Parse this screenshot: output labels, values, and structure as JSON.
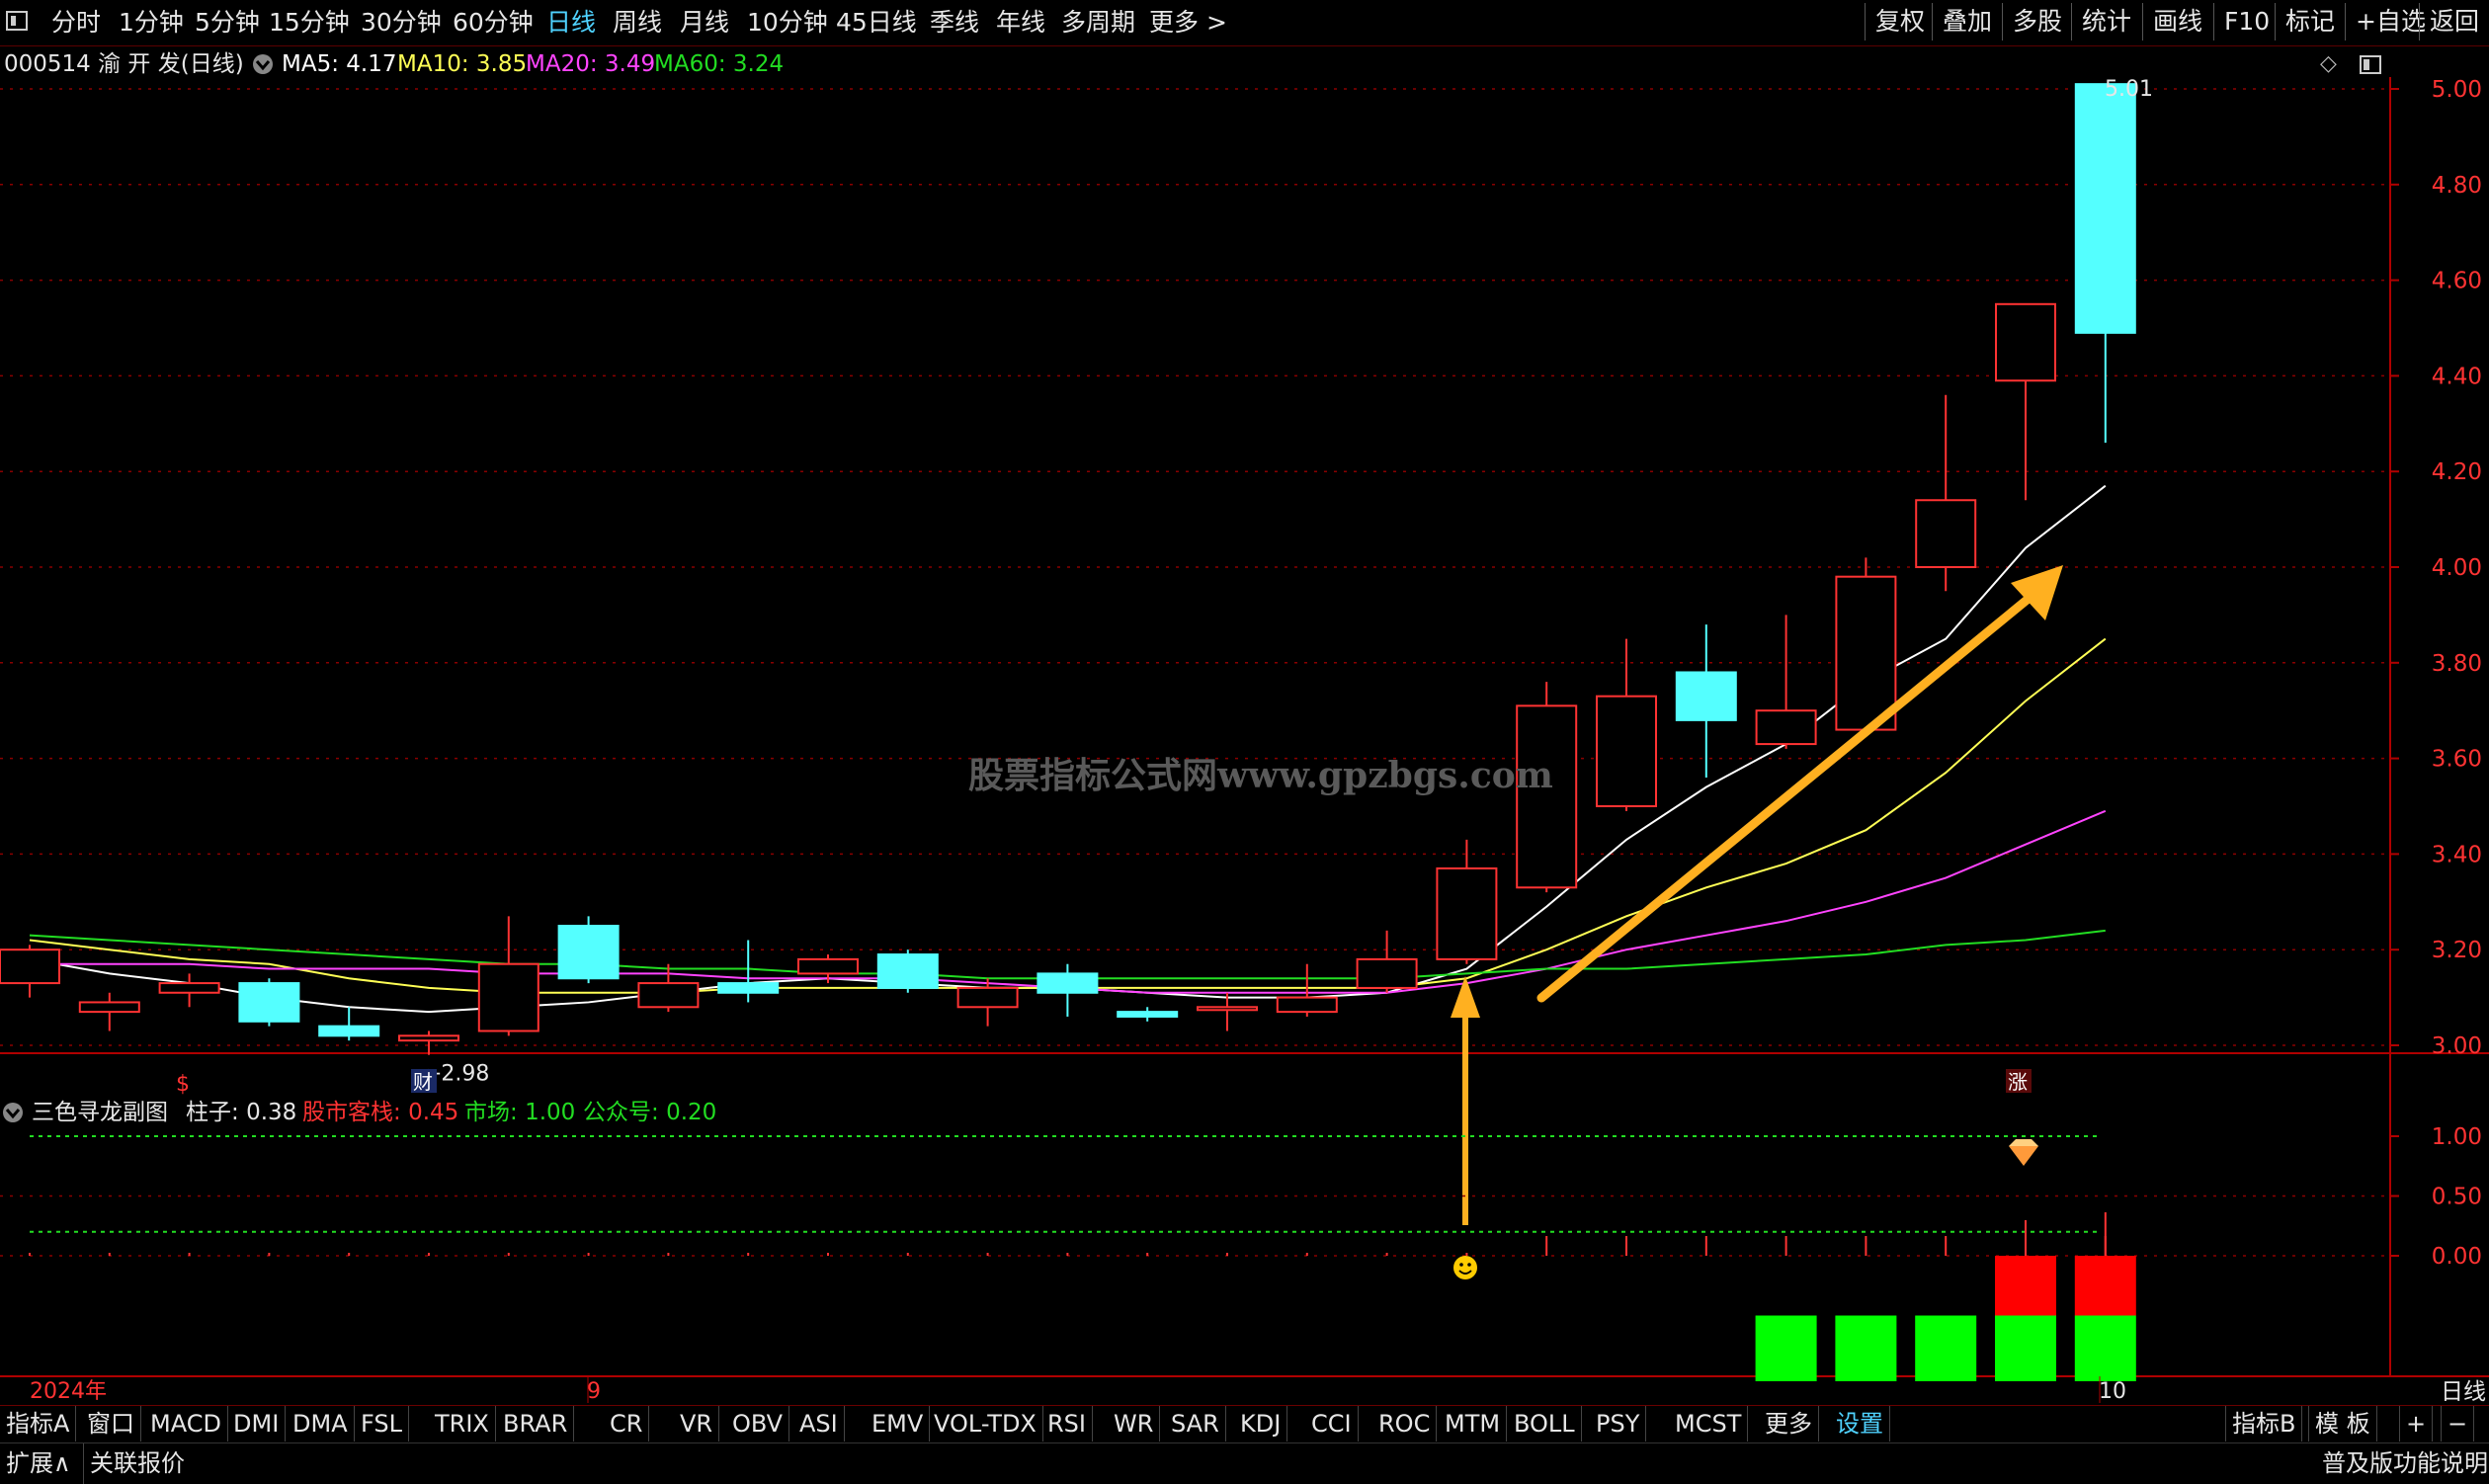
{
  "toolbar": {
    "periods": [
      "分时",
      "1分钟",
      "5分钟",
      "15分钟",
      "30分钟",
      "60分钟",
      "日线",
      "周线",
      "月线",
      "10分钟",
      "45日线",
      "季线",
      "年线",
      "多周期",
      "更多 >"
    ],
    "active_period": "日线",
    "right_buttons": [
      "复权",
      "叠加",
      "多股",
      "统计",
      "画线",
      "F10",
      "标记",
      "+自选",
      "返回"
    ]
  },
  "stock": {
    "code_name": "000514 渝 开 发(日线)",
    "ma5_label": "MA5:",
    "ma5_value": "4.17",
    "ma10_label": "MA10:",
    "ma10_value": "3.85",
    "ma20_label": "MA20:",
    "ma20_value": "3.49",
    "ma60_label": "MA60:",
    "ma60_value": "3.24"
  },
  "colors": {
    "ma5": "#ffffff",
    "ma10": "#ffff55",
    "ma20": "#ff44ff",
    "ma60": "#22dd22",
    "up": "#ff3333",
    "down": "#54ffff",
    "accent": "#4fd2ff",
    "arrow": "#ffb020"
  },
  "watermark": "股票指标公式网www.gpzbgs.com",
  "price_axis": [
    "5.00",
    "4.80",
    "4.60",
    "4.40",
    "4.20",
    "4.00",
    "3.80",
    "3.60",
    "3.40",
    "3.20",
    "3.00"
  ],
  "annotations": {
    "high_label": "5.01",
    "low_label": "←2.98",
    "cai_marker": "财",
    "zhang_marker": "涨",
    "dollar_marker": "$"
  },
  "sub_chart": {
    "title": "三色寻龙副图",
    "zhuzi_label": "柱子:",
    "zhuzi_value": "0.38",
    "gushi_label": "股市客栈:",
    "gushi_value": "0.45",
    "shichang_label": "市场:",
    "shichang_value": "1.00",
    "gzh_label": "公众号:",
    "gzh_value": "0.20",
    "axis": [
      "1.00",
      "0.50",
      "0.00"
    ]
  },
  "date_axis": {
    "year_label": "2024年",
    "month_9": "9",
    "month_10": "10",
    "period_label": "日线"
  },
  "indicator_tabs": [
    "指标A",
    "窗口",
    "MACD",
    "DMI",
    "DMA",
    "FSL",
    "TRIX",
    "BRAR",
    "CR",
    "VR",
    "OBV",
    "ASI",
    "EMV",
    "VOL-TDX",
    "RSI",
    "WR",
    "SAR",
    "KDJ",
    "CCI",
    "ROC",
    "MTM",
    "BOLL",
    "PSY",
    "MCST",
    "更多",
    "设置"
  ],
  "active_tab": "设置",
  "bottom_right": [
    "指标B",
    "模 板",
    "+",
    "−"
  ],
  "status": {
    "expand": "扩展∧",
    "related_quote": "关联报价",
    "edition": "普及版功能说明"
  },
  "chart_data": {
    "type": "candlestick",
    "ylim": [
      2.9,
      5.05
    ],
    "candles": [
      {
        "o": 3.13,
        "c": 3.2,
        "h": 3.21,
        "l": 3.1
      },
      {
        "o": 3.07,
        "c": 3.09,
        "h": 3.11,
        "l": 3.03
      },
      {
        "o": 3.11,
        "c": 3.13,
        "h": 3.15,
        "l": 3.08
      },
      {
        "o": 3.13,
        "c": 3.05,
        "h": 3.14,
        "l": 3.04
      },
      {
        "o": 3.04,
        "c": 3.02,
        "h": 3.08,
        "l": 3.01
      },
      {
        "o": 3.01,
        "c": 3.02,
        "h": 3.03,
        "l": 2.98
      },
      {
        "o": 3.03,
        "c": 3.17,
        "h": 3.27,
        "l": 3.02
      },
      {
        "o": 3.25,
        "c": 3.14,
        "h": 3.27,
        "l": 3.13
      },
      {
        "o": 3.08,
        "c": 3.13,
        "h": 3.17,
        "l": 3.07
      },
      {
        "o": 3.13,
        "c": 3.11,
        "h": 3.22,
        "l": 3.09
      },
      {
        "o": 3.15,
        "c": 3.18,
        "h": 3.19,
        "l": 3.13
      },
      {
        "o": 3.19,
        "c": 3.12,
        "h": 3.2,
        "l": 3.11
      },
      {
        "o": 3.08,
        "c": 3.12,
        "h": 3.14,
        "l": 3.04
      },
      {
        "o": 3.15,
        "c": 3.11,
        "h": 3.17,
        "l": 3.06
      },
      {
        "o": 3.07,
        "c": 3.06,
        "h": 3.08,
        "l": 3.05
      },
      {
        "o": 3.08,
        "c": 3.08,
        "h": 3.11,
        "l": 3.03
      },
      {
        "o": 3.07,
        "c": 3.1,
        "h": 3.17,
        "l": 3.06
      },
      {
        "o": 3.12,
        "c": 3.18,
        "h": 3.24,
        "l": 3.11
      },
      {
        "o": 3.18,
        "c": 3.37,
        "h": 3.43,
        "l": 3.17
      },
      {
        "o": 3.33,
        "c": 3.71,
        "h": 3.76,
        "l": 3.32
      },
      {
        "o": 3.5,
        "c": 3.73,
        "h": 3.85,
        "l": 3.49
      },
      {
        "o": 3.78,
        "c": 3.68,
        "h": 3.88,
        "l": 3.56
      },
      {
        "o": 3.63,
        "c": 3.7,
        "h": 3.9,
        "l": 3.62
      },
      {
        "o": 3.66,
        "c": 3.98,
        "h": 4.02,
        "l": 3.65
      },
      {
        "o": 4.0,
        "c": 4.14,
        "h": 4.36,
        "l": 3.95
      },
      {
        "o": 4.39,
        "c": 4.55,
        "h": 4.55,
        "l": 4.14
      },
      {
        "o": 5.01,
        "c": 4.49,
        "h": 5.01,
        "l": 4.26
      }
    ],
    "series": [
      {
        "name": "MA5",
        "values": [
          3.18,
          3.15,
          3.13,
          3.1,
          3.08,
          3.07,
          3.08,
          3.09,
          3.11,
          3.13,
          3.14,
          3.13,
          3.12,
          3.12,
          3.11,
          3.1,
          3.1,
          3.11,
          3.16,
          3.29,
          3.43,
          3.54,
          3.63,
          3.76,
          3.85,
          4.04,
          4.17
        ]
      },
      {
        "name": "MA10",
        "values": [
          3.22,
          3.2,
          3.18,
          3.17,
          3.14,
          3.12,
          3.11,
          3.11,
          3.11,
          3.12,
          3.12,
          3.12,
          3.12,
          3.12,
          3.12,
          3.12,
          3.12,
          3.12,
          3.14,
          3.2,
          3.27,
          3.33,
          3.38,
          3.45,
          3.57,
          3.72,
          3.85
        ]
      },
      {
        "name": "MA20",
        "values": [
          3.17,
          3.17,
          3.17,
          3.16,
          3.16,
          3.16,
          3.15,
          3.15,
          3.15,
          3.14,
          3.14,
          3.14,
          3.13,
          3.12,
          3.11,
          3.11,
          3.11,
          3.11,
          3.13,
          3.16,
          3.2,
          3.23,
          3.26,
          3.3,
          3.35,
          3.42,
          3.49
        ]
      },
      {
        "name": "MA60",
        "values": [
          3.23,
          3.22,
          3.21,
          3.2,
          3.19,
          3.18,
          3.17,
          3.17,
          3.16,
          3.16,
          3.15,
          3.15,
          3.14,
          3.14,
          3.14,
          3.14,
          3.14,
          3.14,
          3.15,
          3.16,
          3.16,
          3.17,
          3.18,
          3.19,
          3.21,
          3.22,
          3.24
        ]
      }
    ],
    "sub": {
      "ylim": [
        -1.0,
        1.2
      ],
      "green_bars": [
        22,
        23,
        24,
        25,
        26
      ],
      "green_value": -1.0,
      "red_bars": [
        25,
        26
      ],
      "red_value": 0.0,
      "red_bottom": -0.5,
      "lines": [
        1.0,
        0.2
      ]
    }
  }
}
